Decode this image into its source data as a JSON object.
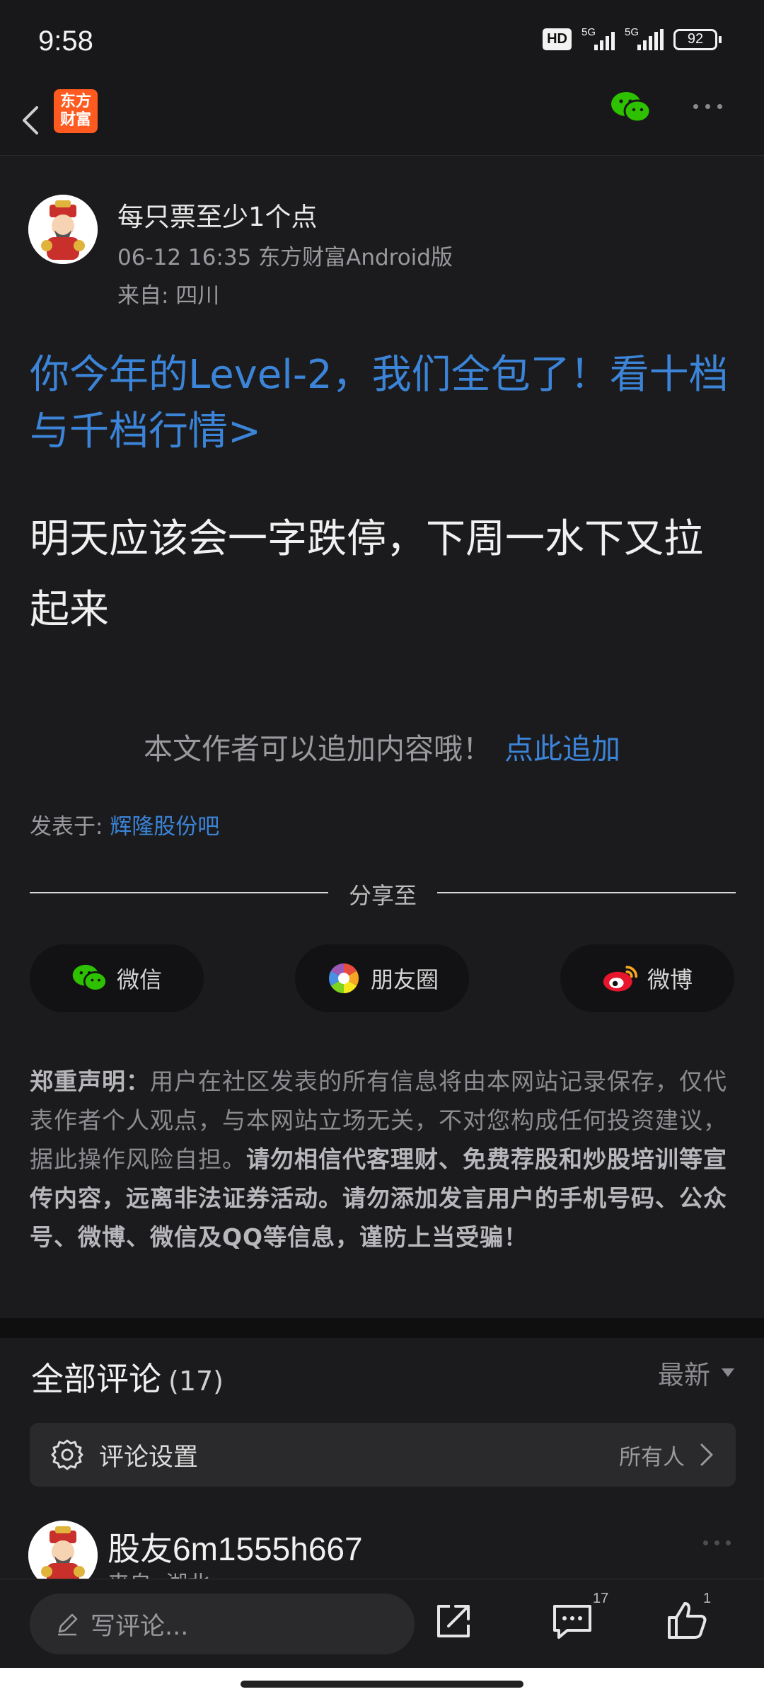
{
  "status_bar": {
    "time": "9:58",
    "hd": "HD",
    "net1": "5G",
    "net2": "5G",
    "battery": "92"
  },
  "nav": {
    "app_logo_text": "东方\n财富",
    "back_icon": "chevron-left-icon",
    "share_icon": "wechat-icon",
    "more_icon": "more-horizontal-icon"
  },
  "post": {
    "author": "每只票至少1个点",
    "meta": "06-12 16:35 东方财富Android版",
    "location": "来自: 四川",
    "promo_link": "你今年的Level-2，我们全包了！看十档与千档行情>",
    "body": "明天应该会一字跌停，下周一水下又拉起来",
    "append_text": "本文作者可以追加内容哦！",
    "append_link": "点此追加",
    "posted_in_label": "发表于: ",
    "posted_in_bar": "辉隆股份吧"
  },
  "share": {
    "label": "分享至",
    "buttons": [
      {
        "label": "微信",
        "icon": "wechat-icon"
      },
      {
        "label": "朋友圈",
        "icon": "moments-icon"
      },
      {
        "label": "微博",
        "icon": "weibo-icon"
      }
    ]
  },
  "disclaimer": {
    "title": "郑重声明：",
    "normal": "用户在社区发表的所有信息将由本网站记录保存，仅代表作者个人观点，与本网站立场无关，不对您构成任何投资建议，据此操作风险自担。",
    "bold": "请勿相信代客理财、免费荐股和炒股培训等宣传内容，远离非法证券活动。请勿添加发言用户的手机号码、公众号、微博、微信及QQ等信息，谨防上当受骗！"
  },
  "comments": {
    "title": "全部评论",
    "count": "(17)",
    "sort": "最新",
    "settings_label": "评论设置",
    "settings_value": "所有人",
    "first": {
      "name": "股友6m1555h667",
      "location": "来自: 湖北"
    }
  },
  "bottom_bar": {
    "input_placeholder": "写评论...",
    "comment_count": "17",
    "like_count": "1"
  },
  "colors": {
    "link": "#3b84d8",
    "wechat_green": "#2dc100",
    "brand_orange": "#ff5a1f",
    "background": "#1b1b1d"
  }
}
